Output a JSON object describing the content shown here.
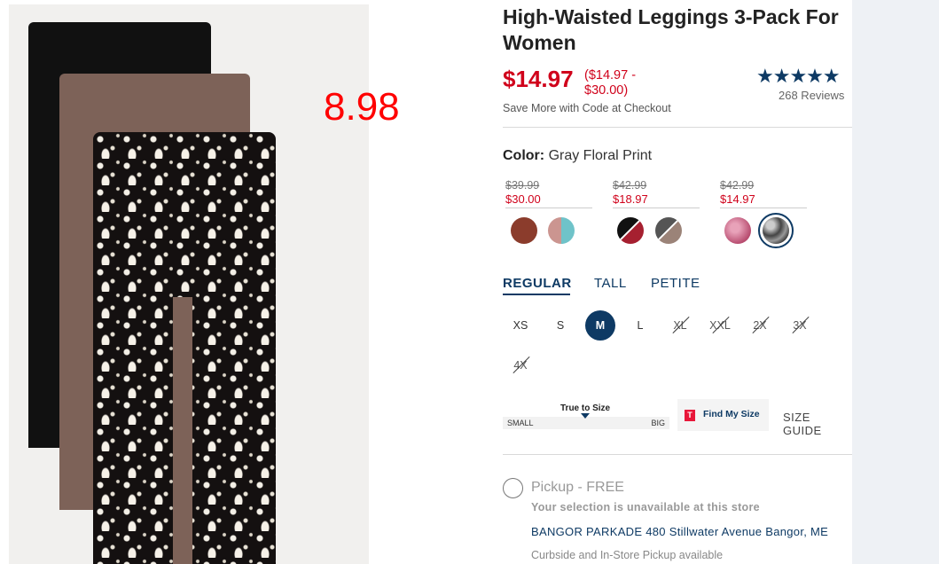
{
  "overlay": {
    "price_note": "8.98"
  },
  "product": {
    "title": "High-Waisted Leggings 3-Pack For Women",
    "price": "$14.97",
    "price_range": "($14.97 - $30.00)",
    "save_note": "Save More with Code at Checkout",
    "rating_stars": "★★★★★",
    "rating_value": 4.5,
    "reviews": "268 Reviews"
  },
  "color": {
    "label": "Color:",
    "value": "Gray Floral Print",
    "groups": [
      {
        "old_price": "$39.99",
        "sale_price": "$30.00",
        "swatches": [
          "brown-swatch",
          "rose-aqua-swatch"
        ]
      },
      {
        "old_price": "$42.99",
        "sale_price": "$18.97",
        "swatches": [
          "black-red-swatch",
          "taupe-swatch"
        ]
      },
      {
        "old_price": "$42.99",
        "sale_price": "$14.97",
        "swatches": [
          "pink-swatch",
          "gray-floral-swatch"
        ]
      }
    ],
    "selected_swatch": "gray-floral-swatch"
  },
  "fit_tabs": {
    "regular": "REGULAR",
    "tall": "TALL",
    "petite": "PETITE",
    "active": "REGULAR"
  },
  "sizes": {
    "xs": "XS",
    "s": "S",
    "m": "M",
    "l": "L",
    "xl": "XL",
    "xxl": "XXL",
    "2x": "2X",
    "3x": "3X",
    "4x": "4X",
    "selected": "M",
    "unavailable": [
      "XL",
      "XXL",
      "2X",
      "3X",
      "4X"
    ]
  },
  "fit_scale": {
    "label": "True to Size",
    "small": "SMALL",
    "big": "BIG"
  },
  "find_size": {
    "icon": "T",
    "label": "Find My Size"
  },
  "size_guide": "SIZE GUIDE",
  "pickup": {
    "label": "Pickup - FREE",
    "status": "Your selection is unavailable at this store",
    "store": "BANGOR PARKADE 480 Stillwater Avenue  Bangor, ME",
    "note": "Curbside and In-Store Pickup available"
  },
  "colors": {
    "accent": "#0e3a64",
    "sale": "#d0021b",
    "overlay": "#ff0000"
  }
}
